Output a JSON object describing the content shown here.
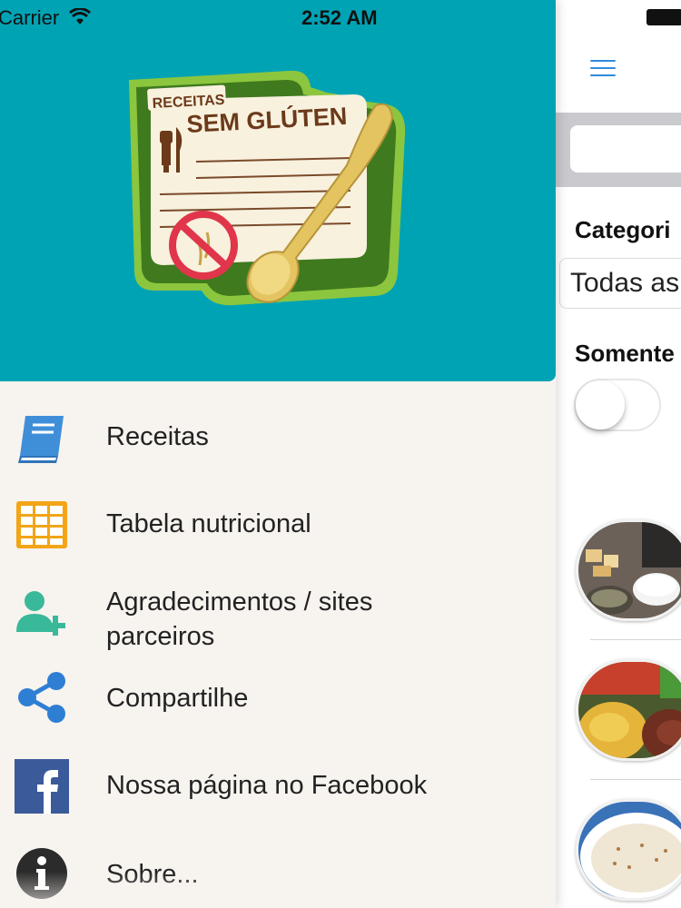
{
  "status_bar": {
    "carrier": "Carrier",
    "time": "2:52 AM"
  },
  "logo": {
    "line1": "RECEITAS",
    "line2": "SEM GLÚTEN"
  },
  "menu": {
    "items": [
      {
        "label": "Receitas",
        "icon": "book-icon"
      },
      {
        "label": "Tabela nutricional",
        "icon": "table-grid-icon"
      },
      {
        "label": "Agradecimentos / sites\nparceiros",
        "icon": "add-user-icon"
      },
      {
        "label": "Compartilhe",
        "icon": "share-icon"
      },
      {
        "label": "Nossa página no Facebook",
        "icon": "facebook-icon"
      },
      {
        "label": "Sobre...",
        "icon": "info-icon"
      }
    ]
  },
  "main": {
    "categories_label": "Categori",
    "category_value": "Todas as",
    "only_label": "Somente",
    "toggle_on": false
  },
  "colors": {
    "header_teal": "#00a3b4",
    "menu_background": "#f7f3ef",
    "accent_blue": "#2e8bdc",
    "grid_orange": "#f2a516",
    "user_green": "#3ab89a",
    "facebook_blue": "#3b5a9a"
  }
}
